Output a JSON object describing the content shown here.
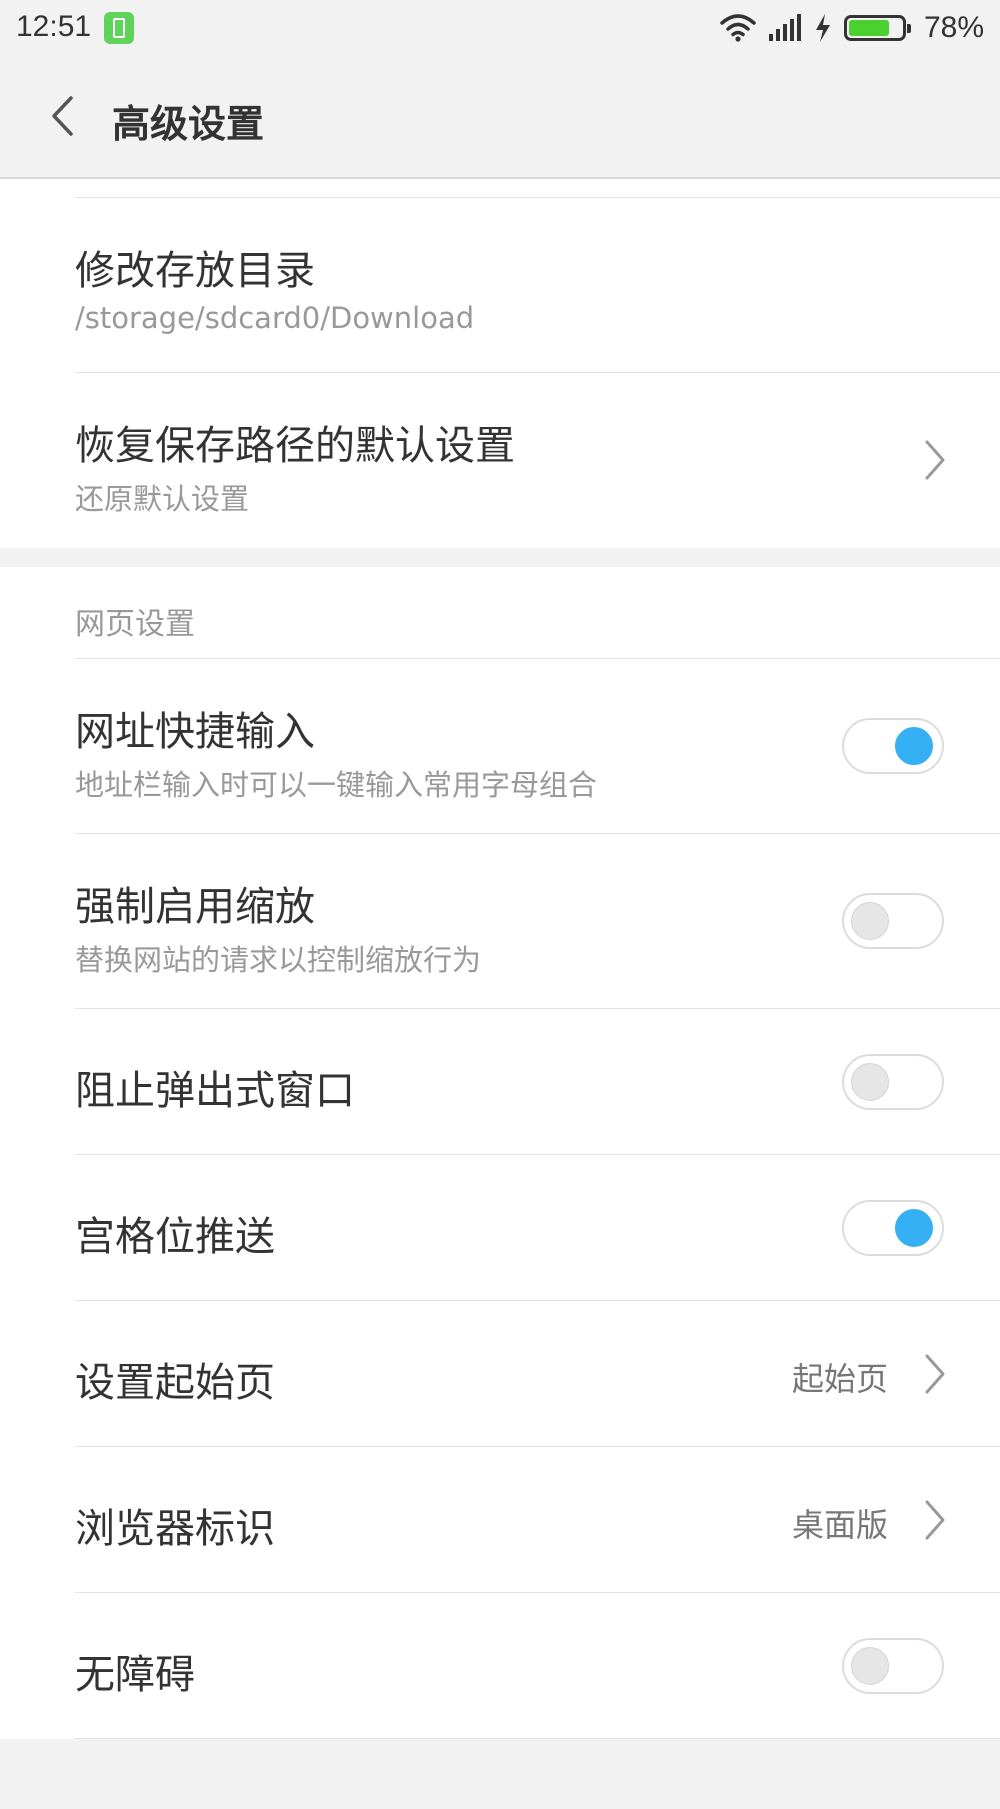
{
  "status_bar": {
    "time": "12:51",
    "battery_percent": "78%",
    "battery_level": 0.78,
    "icons": [
      "battery-app-icon",
      "wifi-icon",
      "signal-icon",
      "charging-icon",
      "battery-icon"
    ]
  },
  "header": {
    "title": "高级设置",
    "back_icon": "chevron-left-icon"
  },
  "storage": {
    "items": [
      {
        "title": "修改存放目录",
        "subtitle": "/storage/sdcard0/Download"
      },
      {
        "title": "恢复保存路径的默认设置",
        "subtitle": "还原默认设置",
        "icon": "chevron-right-icon"
      }
    ]
  },
  "web_settings": {
    "section_label": "网页设置",
    "items": [
      {
        "title": "网址快捷输入",
        "subtitle": "地址栏输入时可以一键输入常用字母组合",
        "toggle": true
      },
      {
        "title": "强制启用缩放",
        "subtitle": "替换网站的请求以控制缩放行为",
        "toggle": false
      },
      {
        "title": "阻止弹出式窗口",
        "toggle": false
      },
      {
        "title": "宫格位推送",
        "toggle": true
      },
      {
        "title": "设置起始页",
        "value": "起始页",
        "icon": "chevron-right-icon"
      },
      {
        "title": "浏览器标识",
        "value": "桌面版",
        "icon": "chevron-right-icon"
      },
      {
        "title": "无障碍",
        "toggle": false
      }
    ]
  },
  "colors": {
    "accent": "#36b0f5",
    "background": "#f2f2f2",
    "card": "#ffffff",
    "battery_green": "#4bd12f"
  }
}
